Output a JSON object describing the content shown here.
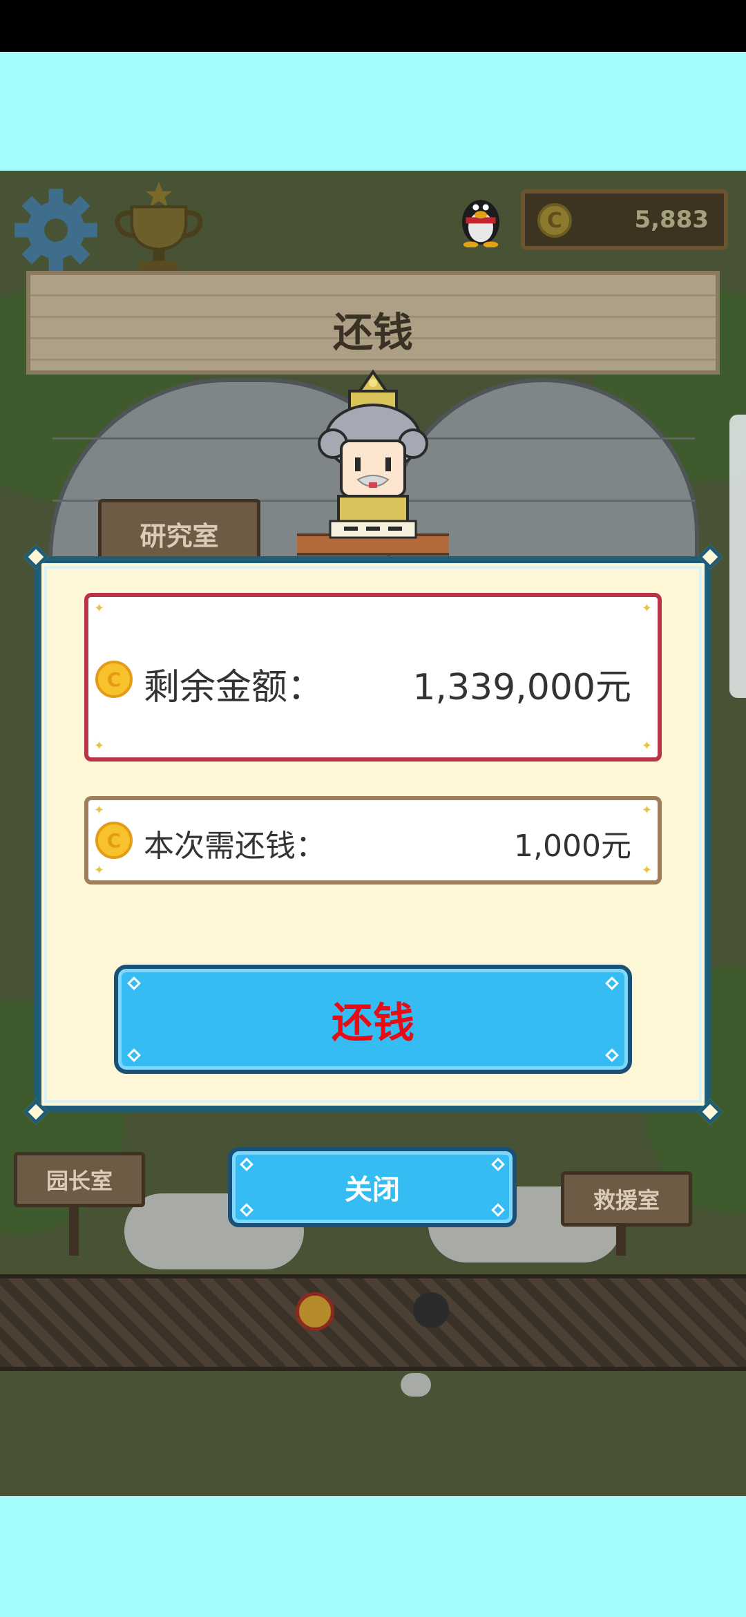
{
  "hud": {
    "coin_count": "5,883",
    "settings_icon": "gear-icon",
    "trophy_icon": "trophy-icon",
    "penguin_icon": "qq-penguin-icon"
  },
  "banner": {
    "title": "还钱"
  },
  "scene": {
    "signs": {
      "research": "研究室",
      "director": "园长室",
      "rescue": "救援室"
    }
  },
  "dialog": {
    "remaining": {
      "label": "剩余金额：",
      "value": "1,339,000元"
    },
    "repay_amount": {
      "label": "本次需还钱：",
      "value": "1,000元"
    },
    "repay_button": "还钱",
    "close_button": "关闭"
  },
  "colors": {
    "dialog_bg": "#fdf7d7",
    "dialog_border": "#1f5c75",
    "button_blue": "#35bdf3",
    "repay_text": "#e80c14",
    "remaining_border": "#b73446",
    "repay_border": "#9e7f5a",
    "coin_gold": "#f7c22b"
  }
}
